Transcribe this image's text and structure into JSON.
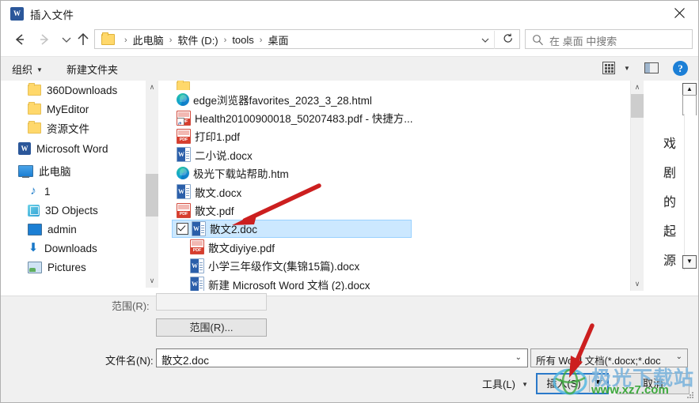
{
  "window": {
    "title": "插入文件",
    "app_icon": "word-icon",
    "close_label": "×"
  },
  "nav": {
    "back_icon": "arrow-left-icon",
    "forward_icon": "arrow-right-icon",
    "recent_icon": "chevron-down-icon",
    "up_icon": "arrow-up-icon",
    "breadcrumb": [
      "此电脑",
      "软件 (D:)",
      "tools",
      "桌面"
    ],
    "breadcrumb_separator": "›",
    "dropdown_icon": "chevron-down-icon",
    "refresh_icon": "refresh-icon",
    "search_placeholder": "在 桌面 中搜索",
    "search_icon": "search-icon"
  },
  "command_bar": {
    "organize": "组织",
    "new_folder": "新建文件夹",
    "view_icon": "grid-view-icon",
    "view_dropdown_icon": "chevron-down-icon",
    "preview_pane_icon": "preview-pane-icon",
    "help_icon": "?"
  },
  "nav_pane": {
    "items": [
      {
        "label": "360Downloads",
        "icon": "folder-icon",
        "indent": 34
      },
      {
        "label": "MyEditor",
        "icon": "folder-icon",
        "indent": 34
      },
      {
        "label": "资源文件",
        "icon": "folder-icon",
        "indent": 34
      },
      {
        "label": "Microsoft Word",
        "icon": "word-icon",
        "indent": 22
      },
      {
        "label": "此电脑",
        "icon": "this-pc-icon",
        "indent": 22
      },
      {
        "label": "1",
        "icon": "music-icon",
        "indent": 34
      },
      {
        "label": "3D Objects",
        "icon": "3d-objects-icon",
        "indent": 34
      },
      {
        "label": "admin",
        "icon": "desktop-icon",
        "indent": 34
      },
      {
        "label": "Downloads",
        "icon": "downloads-icon",
        "indent": 34
      },
      {
        "label": "Pictures",
        "icon": "pictures-icon",
        "indent": 34
      }
    ],
    "scroll_up_icon": "chevron-up-icon",
    "scroll_down_icon": "chevron-down-icon"
  },
  "file_list": {
    "files": [
      {
        "name": "",
        "icon": "folder-icon",
        "selected": false,
        "partial": true
      },
      {
        "name": "edge浏览器favorites_2023_3_28.html",
        "icon": "edge-icon",
        "selected": false
      },
      {
        "name": "Health20100900018_50207483.pdf - 快捷方...",
        "icon": "pdf-shortcut-icon",
        "selected": false
      },
      {
        "name": "打印1.pdf",
        "icon": "pdf-icon",
        "selected": false
      },
      {
        "name": "二小说.docx",
        "icon": "word-doc-icon",
        "selected": false
      },
      {
        "name": "极光下载站帮助.htm",
        "icon": "edge-icon",
        "selected": false
      },
      {
        "name": "散文.docx",
        "icon": "word-doc-icon",
        "selected": false
      },
      {
        "name": "散文.pdf",
        "icon": "pdf-icon",
        "selected": false
      },
      {
        "name": "散文2.doc",
        "icon": "word-doc-icon",
        "selected": true,
        "checked": true
      },
      {
        "name": "散文diyiye.pdf",
        "icon": "pdf-icon",
        "selected": false
      },
      {
        "name": "小学三年级作文(集锦15篇).docx",
        "icon": "word-doc-icon",
        "selected": false
      },
      {
        "name": "新建 Microsoft Word 文档 (2).docx",
        "icon": "word-doc-icon",
        "selected": false
      }
    ],
    "scroll_up_icon": "chevron-up-icon",
    "scroll_down_icon": "chevron-down-icon"
  },
  "preview": {
    "text_chars": [
      "戏",
      "剧",
      "的",
      "起",
      "源"
    ],
    "scroll_up_icon": "triangle-up-icon",
    "scroll_down_icon": "triangle-down-icon"
  },
  "form": {
    "range_label": "范围(R):",
    "range_value": "",
    "range_button": "范围(R)...",
    "filename_label": "文件名(N):",
    "filename_value": "散文2.doc",
    "filename_dropdown_icon": "chevron-down-icon",
    "filetype_value": "所有 Word 文档(*.docx;*.doc",
    "filetype_dropdown_icon": "chevron-down-icon",
    "tools_button": "工具(L)",
    "tools_dropdown_icon": "triangle-down-icon",
    "insert_button": "插入(S)",
    "insert_dropdown_icon": "triangle-down-icon",
    "cancel_button": "取消"
  },
  "watermark": {
    "text": "极光下载站",
    "url": "www.xz7.com"
  },
  "colors": {
    "selection": "#cce8ff",
    "focus_border": "#2a79c9",
    "word_blue": "#2b579a",
    "pdf_red": "#d73e2e",
    "arrow_red": "#cc1f1f",
    "watermark_blue": "#7fb6dd",
    "watermark_green": "#3fa93f"
  },
  "annotations": [
    {
      "name": "arrow-to-selected-file",
      "color": "#cc1f1f"
    },
    {
      "name": "arrow-to-insert-button",
      "color": "#cc1f1f"
    }
  ]
}
